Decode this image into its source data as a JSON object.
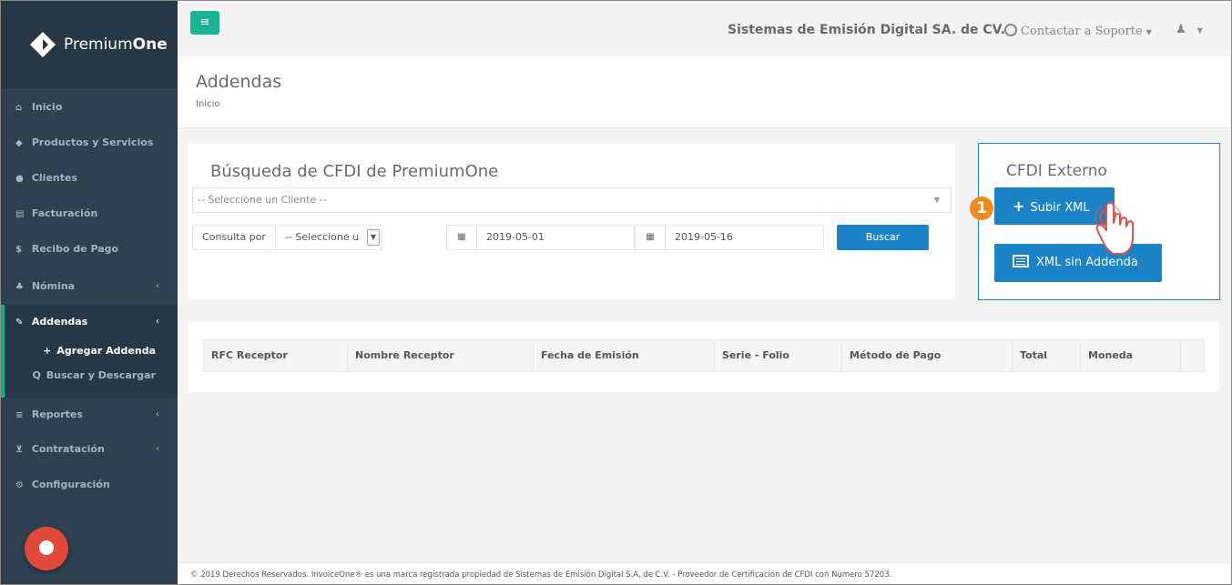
{
  "brand": {
    "name_light": "Premium",
    "name_bold": "One"
  },
  "sidebar": {
    "items": [
      {
        "label": "Inicio"
      },
      {
        "label": "Productos y Servicios"
      },
      {
        "label": "Clientes"
      },
      {
        "label": "Facturación"
      },
      {
        "label": "Recibo de Pago"
      },
      {
        "label": "Nómina"
      },
      {
        "label": "Addendas"
      },
      {
        "label": "Reportes"
      },
      {
        "label": "Contratación"
      },
      {
        "label": "Configuración"
      }
    ],
    "sub_items": [
      {
        "label": "Agregar Addenda"
      },
      {
        "label": "Buscar y Descargar"
      }
    ]
  },
  "topbar": {
    "company": "Sistemas de Emisión Digital SA. de CV.",
    "support": "Contactar a Soporte"
  },
  "page": {
    "title": "Addendas",
    "breadcrumb": "Inicio"
  },
  "search": {
    "title": "Búsqueda de CFDI de PremiumOne",
    "client_placeholder": "-- Seleccione un Cliente --",
    "consulta_label": "Consulta por",
    "consulta_value": "-- Seleccione u",
    "date_from": "2019-05-01",
    "date_to": "2019-05-16",
    "search_button": "Buscar"
  },
  "external": {
    "title": "CFDI Externo",
    "upload_button": "Subir XML",
    "no_addenda_button": "XML sin Addenda",
    "step_badge": "1"
  },
  "table": {
    "columns": [
      "RFC Receptor",
      "Nombre Receptor",
      "Fecha de Emisión",
      "Serie - Folio",
      "Método de Pago",
      "Total",
      "Moneda"
    ]
  },
  "footer": "© 2019 Derechos Reservados. InvoiceOne® es una marca registrada propiedad de Sistemas de Emisión Digital S.A. de C.V. - Proveedor de Certificación de CFDI con Número 57203.",
  "colors": {
    "sidebar": "#2f4050",
    "accent_green": "#1ab394",
    "primary_blue": "#1c84c6",
    "badge_orange": "#f08a24"
  }
}
